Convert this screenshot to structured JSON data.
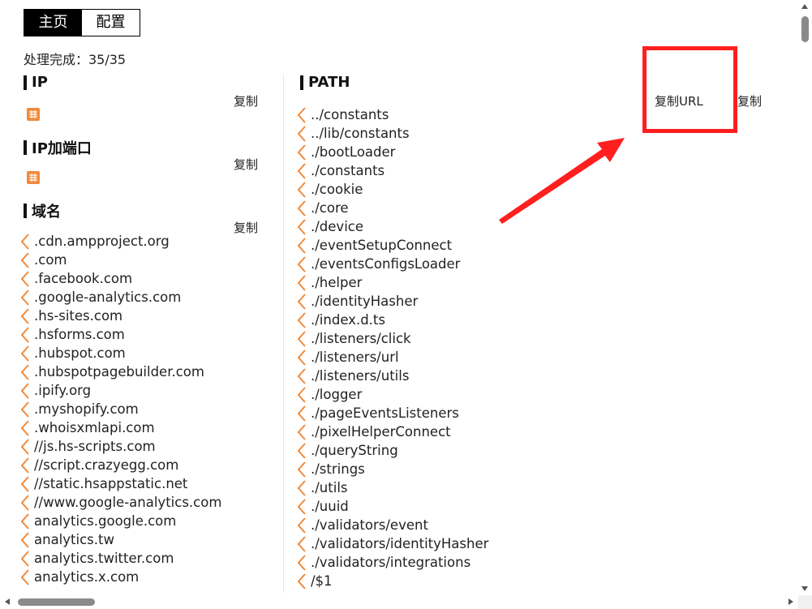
{
  "tabs": [
    {
      "label": "主页",
      "active": true
    },
    {
      "label": "配置",
      "active": false
    }
  ],
  "status": "处理完成：35/35",
  "sections": {
    "ip": {
      "title": "IP",
      "copy": "复制"
    },
    "ip_port": {
      "title": "IP加端口",
      "copy": "复制"
    },
    "domain": {
      "title": "域名",
      "copy": "复制"
    },
    "path": {
      "title": "PATH",
      "copy_url": "复制URL",
      "copy": "复制"
    }
  },
  "domains": [
    ".cdn.ampproject.org",
    ".com",
    ".facebook.com",
    ".google-analytics.com",
    ".hs-sites.com",
    ".hsforms.com",
    ".hubspot.com",
    ".hubspotpagebuilder.com",
    ".ipify.org",
    ".myshopify.com",
    ".whoisxmlapi.com",
    "//js.hs-scripts.com",
    "//script.crazyegg.com",
    "//static.hsappstatic.net",
    "//www.google-analytics.com",
    "analytics.google.com",
    "analytics.tw",
    "analytics.twitter.com",
    "analytics.x.com"
  ],
  "paths": [
    "../constants",
    "../lib/constants",
    "./bootLoader",
    "./constants",
    "./cookie",
    "./core",
    "./device",
    "./eventSetupConnect",
    "./eventsConfigsLoader",
    "./helper",
    "./identityHasher",
    "./index.d.ts",
    "./listeners/click",
    "./listeners/url",
    "./listeners/utils",
    "./logger",
    "./pageEventsListeners",
    "./pixelHelperConnect",
    "./queryString",
    "./strings",
    "./utils",
    "./uuid",
    "./validators/event",
    "./validators/identityHasher",
    "./validators/integrations",
    "/$1"
  ],
  "colors": {
    "accent": "#f08a3c",
    "annotation": "#ff1f1f"
  },
  "icons": {
    "list_marker": "chevron-left-icon",
    "empty_grid": "grid-icon"
  }
}
